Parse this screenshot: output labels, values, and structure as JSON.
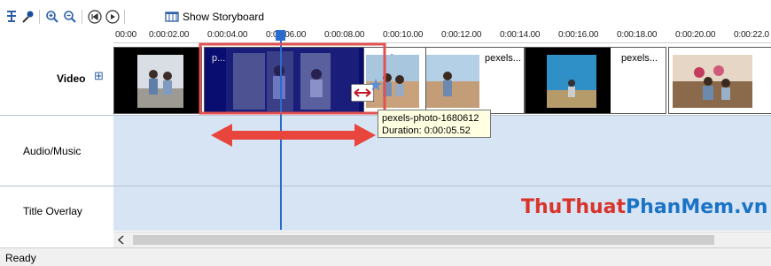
{
  "toolbar": {
    "show_storyboard_label": "Show Storyboard"
  },
  "timeline": {
    "ticks": [
      "00:00",
      "0:00:02.00",
      "0:00:04.00",
      "0:00:06.00",
      "0:00:08.00",
      "0:00:10.00",
      "0:00:12.00",
      "0:00:14.00",
      "0:00:16.00",
      "0:00:18.00",
      "0:00:20.00",
      "0:00:22.0"
    ]
  },
  "tracks": {
    "video": "Video",
    "video_expand": "⊞",
    "audio": "Audio/Music",
    "title_overlay": "Title Overlay"
  },
  "clips": [
    {
      "label": ""
    },
    {
      "label": "p..."
    },
    {
      "label": "pexels..."
    },
    {
      "label": "pexels..."
    },
    {
      "label": "pexels..."
    },
    {
      "label": ""
    }
  ],
  "tooltip": {
    "name": "pexels-photo-1680612",
    "duration": "Duration:  0:00:05.52"
  },
  "watermark": {
    "part1": "Thu",
    "part2": "Thuat",
    "part3": "PhanMem",
    "part4": ".vn"
  },
  "status": {
    "text": "Ready"
  },
  "colors": {
    "lane": "#d6e4f3",
    "playhead": "#2a6bd0",
    "selection": "#e05252",
    "arrow": "#e8453c",
    "watermark_red": "#d9342b",
    "watermark_blue": "#1a73c7"
  }
}
